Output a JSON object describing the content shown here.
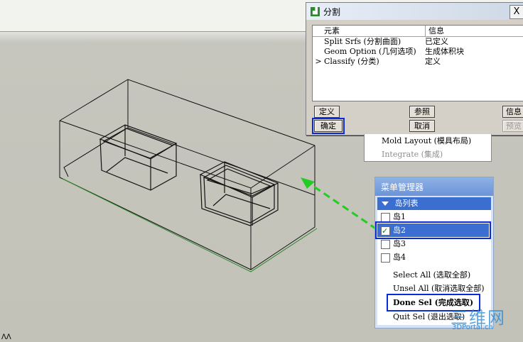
{
  "viewport": {
    "corner_label": "ᐱᐱ"
  },
  "dialog": {
    "title": "分割",
    "close_glyph": "X",
    "columns": [
      "元素",
      "信息"
    ],
    "rows": [
      {
        "marker": "",
        "element": "Split Srfs (分割曲面)",
        "info": "已定义"
      },
      {
        "marker": "",
        "element": "Geom Option (几何选项)",
        "info": "生成体积块"
      },
      {
        "marker": ">",
        "element": "Classify (分类)",
        "info": "定义"
      }
    ],
    "buttons": {
      "define": "定义",
      "reference": "参照",
      "info": "信息",
      "ok": "确定",
      "cancel": "取消",
      "preview": "预览"
    }
  },
  "submenu": {
    "items": [
      {
        "label": "Mold Layout (模具布局)",
        "enabled": true
      },
      {
        "label": "Integrate (集成)",
        "enabled": false
      }
    ]
  },
  "menu_manager": {
    "title": "菜单管理器",
    "list_title": "岛列表",
    "islands": [
      {
        "label": "岛1",
        "checked": false,
        "selected": false
      },
      {
        "label": "岛2",
        "checked": true,
        "selected": true
      },
      {
        "label": "岛3",
        "checked": false,
        "selected": false
      },
      {
        "label": "岛4",
        "checked": false,
        "selected": false
      }
    ],
    "commands": [
      {
        "label": "Select All (选取全部)"
      },
      {
        "label": "Unsel All (取消选取全部)"
      },
      {
        "label": "Done Sel (完成选取)"
      },
      {
        "label": "Quit Sel (退出选取)"
      }
    ]
  },
  "watermark": {
    "brand": "三维网",
    "url": "3DPortal.cn"
  },
  "colors": {
    "highlight_box": "#0b2bd6",
    "arrow": "#22cc22",
    "menu_selected": "#3a6fd1"
  }
}
